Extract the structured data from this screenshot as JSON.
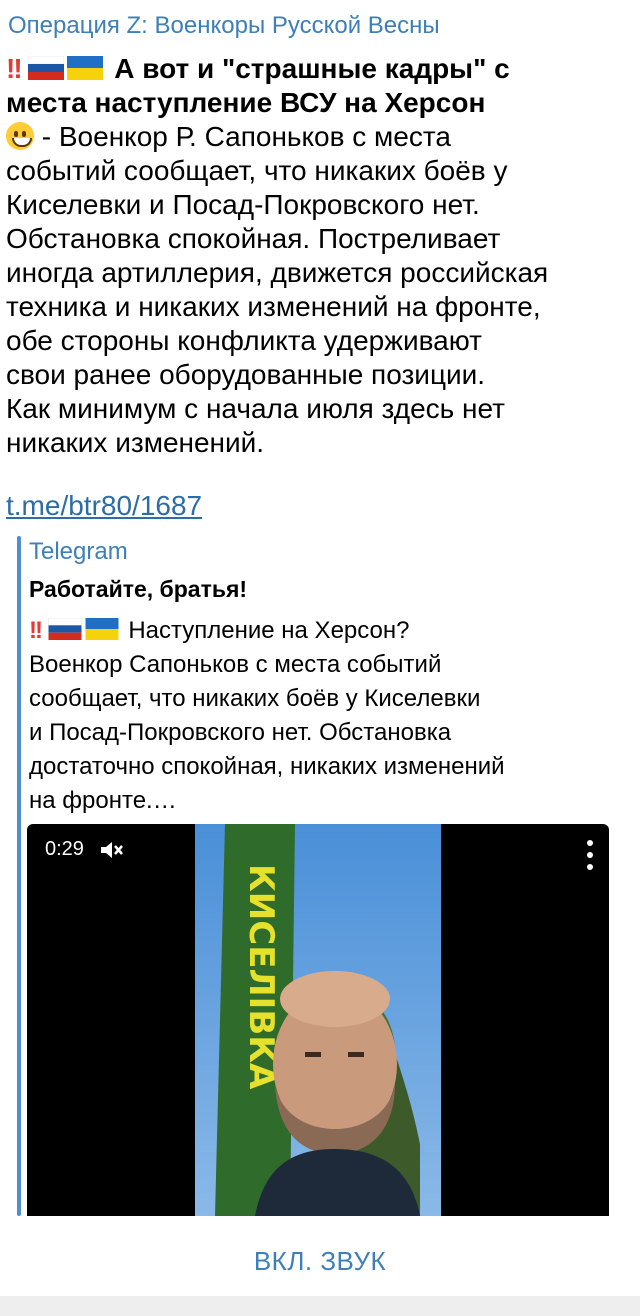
{
  "channel": {
    "name": "Операция Z: Военкоры Русской Весны"
  },
  "post": {
    "title_lines": [
      "А вот и \"страшные кадры\" с",
      "места наступление ВСУ на Херсон"
    ],
    "body_lines": [
      " - Военкор Р. Сапоньков с места",
      "событий сообщает, что никаких боёв у",
      "Киселевки и Посад-Покровского нет.",
      "Обстановка спокойная. Постреливает",
      "иногда артиллерия, движется российская",
      "техника и никаких изменений на фронте,",
      "обе стороны конфликта удерживают",
      "свои ранее оборудованные позиции.",
      "Как минимум с начала июля здесь нет",
      "никаких изменений."
    ],
    "bang": "!!",
    "link": "t.me/btr80/1687"
  },
  "preview": {
    "site": "Telegram",
    "title": "Работайте, братья!",
    "first_line": " Наступление на Херсон?",
    "lines": [
      "Военкор Сапоньков с места событий",
      "сообщает, что никаких боёв у Киселевки",
      "и Посад-Покровского нет. Обстановка",
      "достаточно спокойная, никаких изменений",
      "на фронте.…"
    ],
    "video": {
      "time": "0:29",
      "sign_text": "КИСЕЛІВКА"
    }
  },
  "bottom": {
    "sound_button": "ВКЛ. ЗВУК"
  },
  "colors": {
    "accent": "#3d7fb8",
    "link": "#2e6da4",
    "quote_bar": "#4f8fd0",
    "sign_green": "#2f6b2a",
    "sign_yellow": "#e5e12c"
  }
}
